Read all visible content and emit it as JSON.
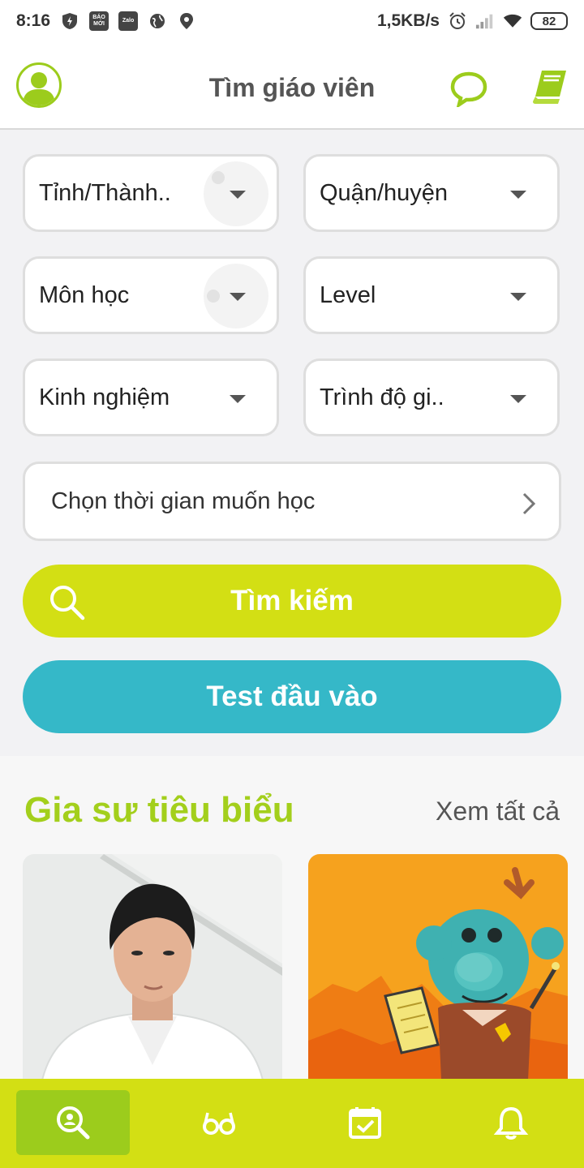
{
  "status_bar": {
    "time": "8:16",
    "network_speed": "1,5KB/s",
    "battery": "82",
    "baomoi_label": "BÁO MỚI",
    "zalo_label": "Zalo",
    "icons": [
      "shield-bolt-icon",
      "baomoi-icon",
      "zalo-icon",
      "globe-icon",
      "location-icon",
      "alarm-icon",
      "signal-icon",
      "wifi-icon",
      "battery-icon"
    ]
  },
  "header": {
    "title": "Tìm giáo viên",
    "icons": [
      "avatar-icon",
      "chat-icon",
      "book-icon"
    ],
    "accent_color": "#9ccc1c"
  },
  "filters": {
    "province": "Tỉnh/Thành..",
    "district": "Quận/huyện",
    "subject": "Môn học",
    "level": "Level",
    "experience": "Kinh nghiệm",
    "qualification": "Trình độ gi..",
    "time_select": "Chọn thời gian muốn học"
  },
  "actions": {
    "search_label": "Tìm kiếm",
    "search_color": "#d3df14",
    "test_label": "Test đầu vào",
    "test_color": "#35b8c8"
  },
  "featured": {
    "title": "Gia sư tiêu biểu",
    "see_all": "Xem tất cả",
    "cards": [
      "tutor-photo",
      "mascot-illustration"
    ]
  },
  "bottom_nav": {
    "items": [
      "search-teacher-icon",
      "glasses-icon",
      "calendar-check-icon",
      "bell-icon"
    ],
    "active_index": 0,
    "bar_color": "#d3df14",
    "active_color": "#9ccc1c"
  }
}
